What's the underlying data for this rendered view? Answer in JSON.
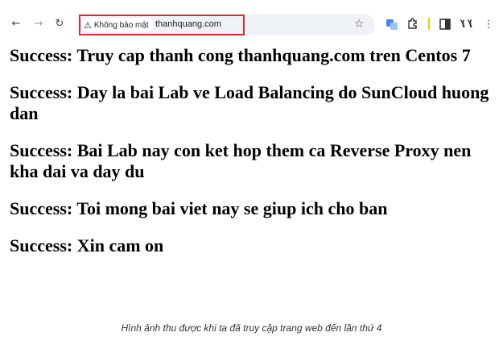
{
  "browser": {
    "back_icon": "arrow-left-icon",
    "forward_icon": "arrow-right-icon",
    "reload_icon": "reload-icon",
    "security_label": "Không bảo mật",
    "url": "thanhquang.com",
    "highlight_color": "#d32f2f"
  },
  "page": {
    "lines": [
      "Success: Truy cap thanh cong thanhquang.com tren Centos 7",
      "Success: Day la bai Lab ve Load Balancing do SunCloud huong dan",
      "Success: Bai Lab nay con ket hop them ca Reverse Proxy nen kha dai va day du",
      "Success: Toi mong bai viet nay se giup ich cho ban",
      "Success: Xin cam on"
    ]
  },
  "caption": "Hình ảnh thu được khi ta đã truy cập trang web đến lần thứ 4"
}
